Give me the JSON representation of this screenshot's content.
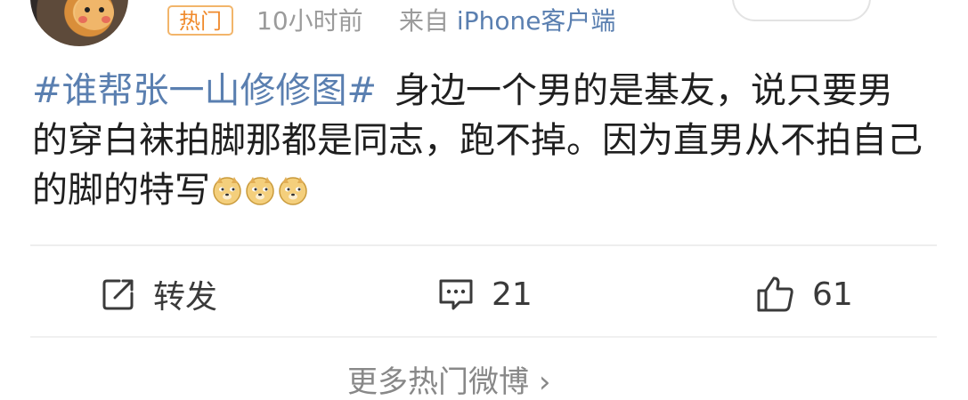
{
  "post": {
    "hot_badge": "热门",
    "time": "10小时前",
    "source_prefix": "来自",
    "source_device": "iPhone客户端",
    "hashtag": "#谁帮张一山修修图#",
    "body": "身边一个男的是基友，说只要男的穿白袜拍脚那都是同志，跑不掉。因为直男从不拍自己的脚的特写",
    "emojis": [
      "doge-emoji",
      "doge-emoji",
      "doge-emoji"
    ]
  },
  "actions": {
    "repost_label": "转发",
    "comment_count": "21",
    "like_count": "61"
  },
  "footer": {
    "more_label": "更多热门微博",
    "more_arrow": "›"
  },
  "colors": {
    "link_blue": "#5a7fb0",
    "hot_orange": "#f08a2c",
    "meta_gray": "#9b9b9b"
  }
}
